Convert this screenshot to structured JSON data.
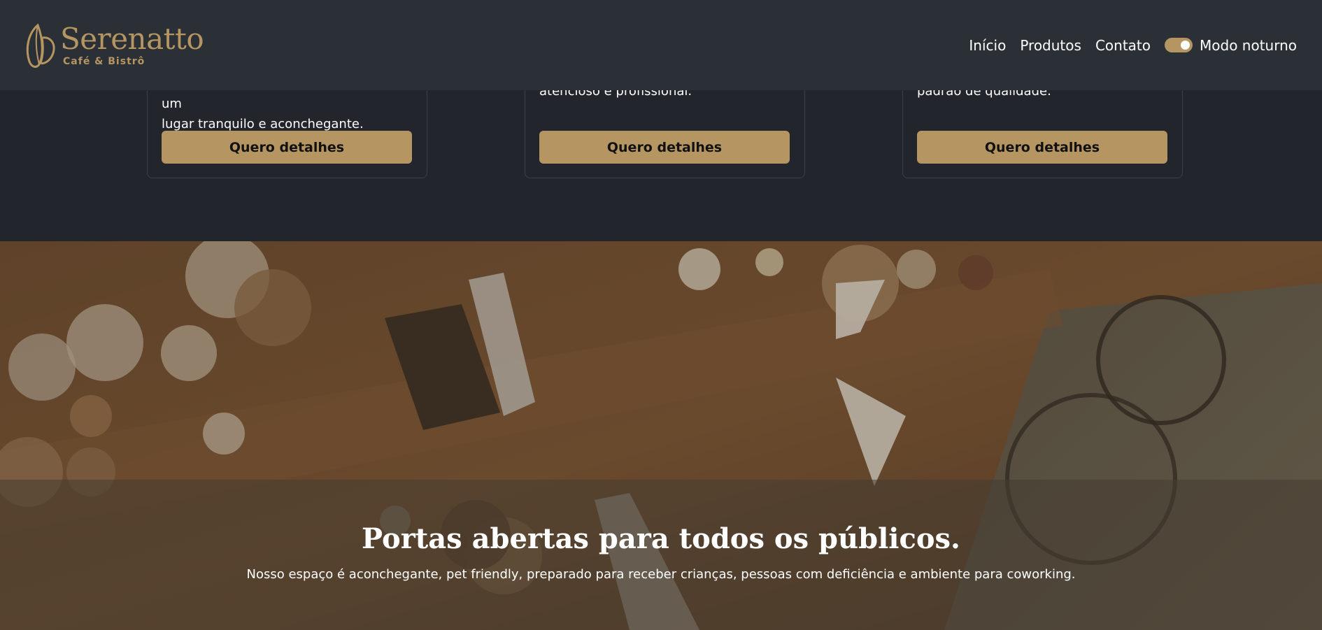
{
  "brand": {
    "name": "Serenatto",
    "subtitle": "Café & Bistrô",
    "logo_icon": "coffee-bean-icon"
  },
  "nav": {
    "items": [
      "Início",
      "Produtos",
      "Contato"
    ],
    "toggle_label": "Modo noturno",
    "toggle_on": true
  },
  "cards": [
    {
      "text_hidden": "ambiente agradável para quem busca um",
      "text": "lugar tranquilo e aconchegante.",
      "button": "Quero detalhes"
    },
    {
      "text": "atencioso e profissional.",
      "button": "Quero detalhes"
    },
    {
      "text": "padrão de qualidade.",
      "button": "Quero detalhes"
    }
  ],
  "hero": {
    "title": "Portas abertas para todos os públicos.",
    "subtitle": "Nosso espaço é aconchegante, pet friendly, preparado para receber crianças, pessoas com deficiência e ambiente para coworking."
  },
  "colors": {
    "accent": "#b59562",
    "navbar": "#2b3036",
    "page": "#22252b"
  }
}
